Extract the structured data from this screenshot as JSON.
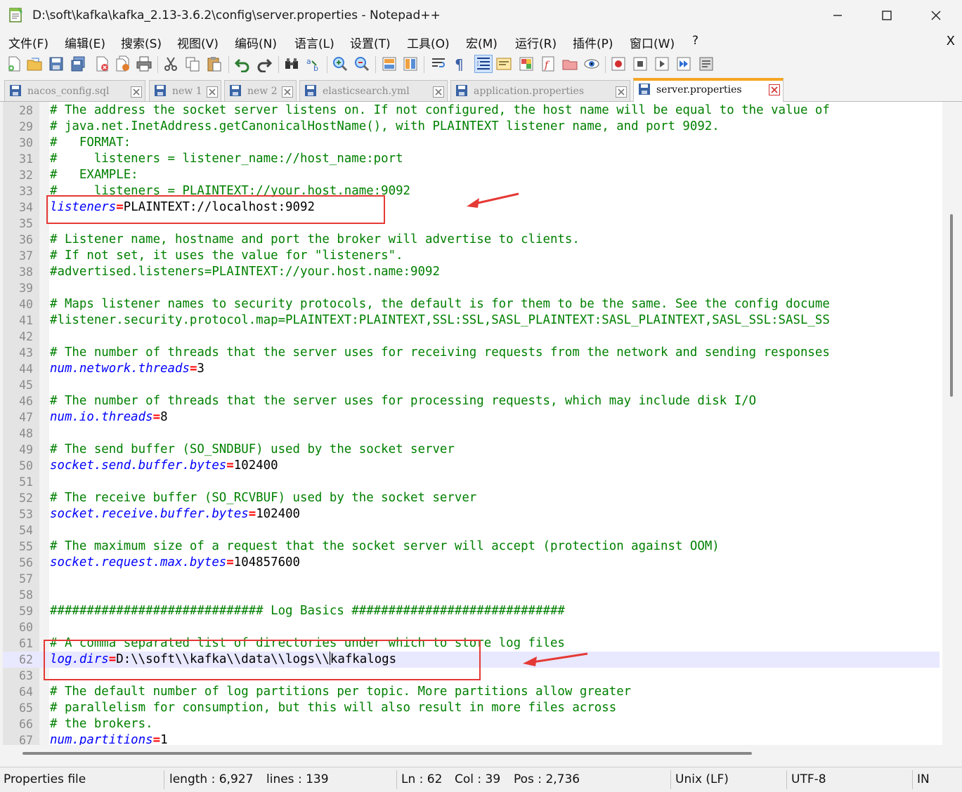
{
  "window": {
    "title": "D:\\soft\\kafka\\kafka_2.13-3.6.2\\config\\server.properties - Notepad++",
    "minimize": "—",
    "maximize": "☐",
    "close": "✕"
  },
  "menu": [
    {
      "id": "file",
      "label": "文件(F)"
    },
    {
      "id": "edit",
      "label": "编辑(E)"
    },
    {
      "id": "search",
      "label": "搜索(S)"
    },
    {
      "id": "view",
      "label": "视图(V)"
    },
    {
      "id": "encoding",
      "label": "编码(N)"
    },
    {
      "id": "language",
      "label": "语言(L)"
    },
    {
      "id": "settings",
      "label": "设置(T)"
    },
    {
      "id": "tools",
      "label": "工具(O)"
    },
    {
      "id": "macro",
      "label": "宏(M)"
    },
    {
      "id": "run",
      "label": "运行(R)"
    },
    {
      "id": "plugins",
      "label": "插件(P)"
    },
    {
      "id": "window",
      "label": "窗口(W)"
    },
    {
      "id": "help",
      "label": "?"
    }
  ],
  "menu_close": "X",
  "tabs": [
    {
      "label": "nacos_config.sql",
      "active": false
    },
    {
      "label": "new 1",
      "active": false
    },
    {
      "label": "new 2",
      "active": false
    },
    {
      "label": "elasticsearch.yml",
      "active": false
    },
    {
      "label": "application.properties",
      "active": false
    },
    {
      "label": "server.properties",
      "active": true
    }
  ],
  "editor": {
    "current_line": "62",
    "lines": [
      {
        "n": "28",
        "t": "# The address the socket server listens on. If not configured, the host name will be equal to the value of"
      },
      {
        "n": "29",
        "t": "# java.net.InetAddress.getCanonicalHostName(), with PLAINTEXT listener name, and port 9092."
      },
      {
        "n": "30",
        "t": "#   FORMAT:"
      },
      {
        "n": "31",
        "t": "#     listeners = listener_name://host_name:port"
      },
      {
        "n": "32",
        "t": "#   EXAMPLE:"
      },
      {
        "n": "33",
        "t": "#     listeners = PLAINTEXT://your.host.name:9092"
      },
      {
        "n": "34",
        "k": "listeners",
        "v": "PLAINTEXT://localhost:9092"
      },
      {
        "n": "35",
        "t": ""
      },
      {
        "n": "36",
        "t": "# Listener name, hostname and port the broker will advertise to clients."
      },
      {
        "n": "37",
        "t": "# If not set, it uses the value for \"listeners\"."
      },
      {
        "n": "38",
        "t": "#advertised.listeners=PLAINTEXT://your.host.name:9092"
      },
      {
        "n": "39",
        "t": ""
      },
      {
        "n": "40",
        "t": "# Maps listener names to security protocols, the default is for them to be the same. See the config docume"
      },
      {
        "n": "41",
        "t": "#listener.security.protocol.map=PLAINTEXT:PLAINTEXT,SSL:SSL,SASL_PLAINTEXT:SASL_PLAINTEXT,SASL_SSL:SASL_SS"
      },
      {
        "n": "42",
        "t": ""
      },
      {
        "n": "43",
        "t": "# The number of threads that the server uses for receiving requests from the network and sending responses"
      },
      {
        "n": "44",
        "k": "num.network.threads",
        "v": "3"
      },
      {
        "n": "45",
        "t": ""
      },
      {
        "n": "46",
        "t": "# The number of threads that the server uses for processing requests, which may include disk I/O"
      },
      {
        "n": "47",
        "k": "num.io.threads",
        "v": "8"
      },
      {
        "n": "48",
        "t": ""
      },
      {
        "n": "49",
        "t": "# The send buffer (SO_SNDBUF) used by the socket server"
      },
      {
        "n": "50",
        "k": "socket.send.buffer.bytes",
        "v": "102400"
      },
      {
        "n": "51",
        "t": ""
      },
      {
        "n": "52",
        "t": "# The receive buffer (SO_RCVBUF) used by the socket server"
      },
      {
        "n": "53",
        "k": "socket.receive.buffer.bytes",
        "v": "102400"
      },
      {
        "n": "54",
        "t": ""
      },
      {
        "n": "55",
        "t": "# The maximum size of a request that the socket server will accept (protection against OOM)"
      },
      {
        "n": "56",
        "k": "socket.request.max.bytes",
        "v": "104857600"
      },
      {
        "n": "57",
        "t": ""
      },
      {
        "n": "58",
        "t": ""
      },
      {
        "n": "59",
        "t": "############################# Log Basics #############################"
      },
      {
        "n": "60",
        "t": ""
      },
      {
        "n": "61",
        "t": "# A comma separated list of directories under which to store log files"
      },
      {
        "n": "62",
        "k": "log.dirs",
        "v": "D:\\\\soft\\\\kafka\\\\data\\\\logs\\\\",
        "v2": "kafkalogs"
      },
      {
        "n": "63",
        "t": ""
      },
      {
        "n": "64",
        "t": "# The default number of log partitions per topic. More partitions allow greater"
      },
      {
        "n": "65",
        "t": "# parallelism for consumption, but this will also result in more files across"
      },
      {
        "n": "66",
        "t": "# the brokers."
      },
      {
        "n": "67",
        "k": "num.partitions",
        "v": "1"
      }
    ]
  },
  "status": {
    "file_type": "Properties file",
    "length": "length : 6,927",
    "lines": "lines : 139",
    "ln": "Ln : 62",
    "col": "Col : 39",
    "pos": "Pos : 2,736",
    "eol": "Unix (LF)",
    "encoding": "UTF-8",
    "mode": "IN"
  },
  "colors": {
    "comment": "#008000",
    "key": "#0000ff",
    "operator": "#ff0000",
    "annotation": "#e53935",
    "active_tab_accent": "#f5a524"
  }
}
